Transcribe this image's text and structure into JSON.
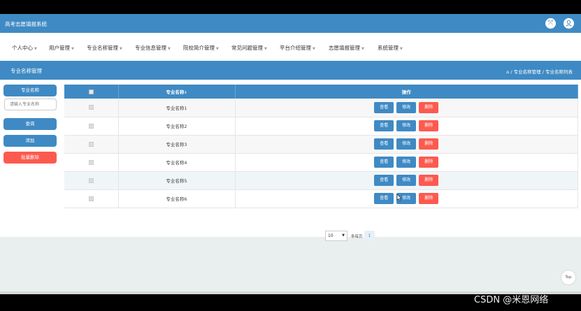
{
  "app": {
    "title": "高考志愿填报系统"
  },
  "header": {
    "fullscreen_icon": "fullscreen-icon",
    "user_icon": "user-icon"
  },
  "menu": [
    {
      "label": "个人中心"
    },
    {
      "label": "用户管理"
    },
    {
      "label": "专业名称管理"
    },
    {
      "label": "专业信息管理"
    },
    {
      "label": "院校简介管理"
    },
    {
      "label": "常见问题管理"
    },
    {
      "label": "平台介绍管理"
    },
    {
      "label": "志愿填报管理"
    },
    {
      "label": "系统管理"
    }
  ],
  "breadcrumb": {
    "page_title": "专业名称管理",
    "home_icon": "home-icon",
    "path": "/ 专业名称管理 / 专业名称列表"
  },
  "sidebar": {
    "field_label": "专业名称",
    "search_placeholder": "请输入专业名称",
    "search_button": "查询",
    "add_button": "添加",
    "batch_delete_button": "批量删除"
  },
  "table": {
    "headers": {
      "name": "专业名称",
      "actions": "操作"
    },
    "rows": [
      {
        "name": "专业名称1"
      },
      {
        "name": "专业名称2"
      },
      {
        "name": "专业名称3"
      },
      {
        "name": "专业名称4"
      },
      {
        "name": "专业名称5"
      },
      {
        "name": "专业名称6"
      }
    ],
    "actions": {
      "view": "查看",
      "edit": "修改",
      "delete": "删除"
    }
  },
  "pagination": {
    "page_size": "10",
    "page_size_label": "条每页",
    "current_page": "1"
  },
  "back_to_top": "Top",
  "watermark": "CSDN @米恩网络",
  "colors": {
    "primary": "#3f8ac4",
    "danger": "#fd5a4f",
    "background": "#e9efee"
  }
}
